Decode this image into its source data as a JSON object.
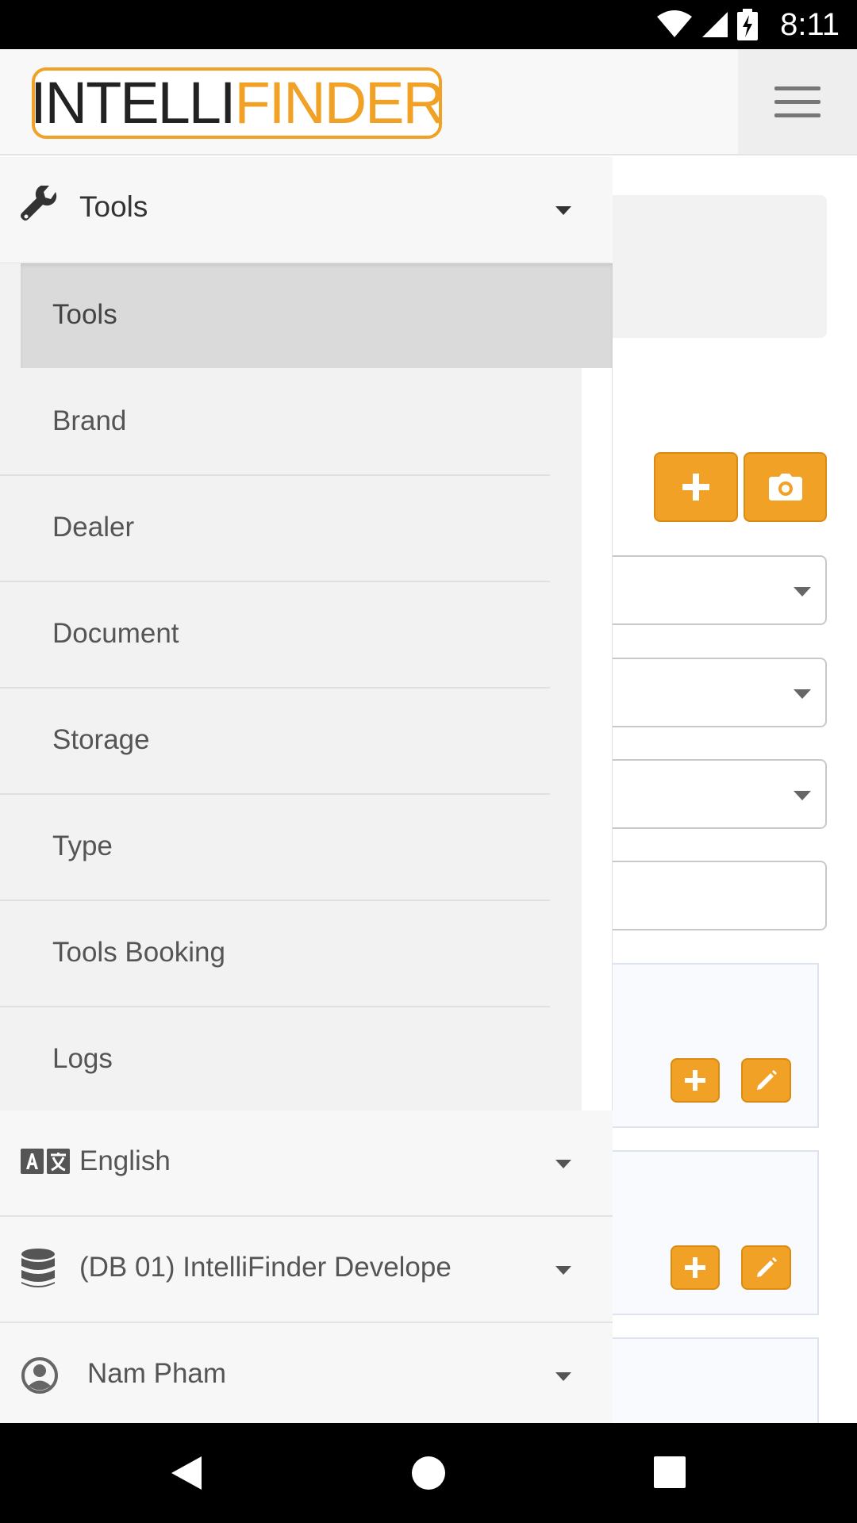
{
  "status_bar": {
    "time": "8:11"
  },
  "header": {
    "logo_text_dark": "INTELLI",
    "logo_text_accent": "FINDER",
    "menu_icon": "hamburger-icon"
  },
  "drawer": {
    "section": {
      "label": "Tools",
      "icon": "wrench-icon"
    },
    "submenu": [
      {
        "label": "Tools"
      },
      {
        "label": "Brand"
      },
      {
        "label": "Dealer"
      },
      {
        "label": "Document"
      },
      {
        "label": "Storage"
      },
      {
        "label": "Type"
      },
      {
        "label": "Tools Booking"
      },
      {
        "label": "Logs"
      }
    ],
    "language": {
      "label": "English",
      "icon": "translate-icon"
    },
    "database": {
      "label": "(DB 01) IntelliFinder Develope",
      "icon": "database-icon"
    },
    "user": {
      "label": "Nam Pham",
      "icon": "account-circle-icon"
    }
  },
  "background_page": {
    "buttons": [
      "plus-icon",
      "camera-icon",
      "pencil-icon"
    ]
  },
  "colors": {
    "accent": "#f0a126",
    "drawer_bg": "#f7f7f7",
    "submenu_bg": "#f2f2f2",
    "active_item_bg": "#dadada"
  },
  "nav_bar": {
    "back": "back-icon",
    "home": "home-icon",
    "recents": "recents-icon"
  }
}
